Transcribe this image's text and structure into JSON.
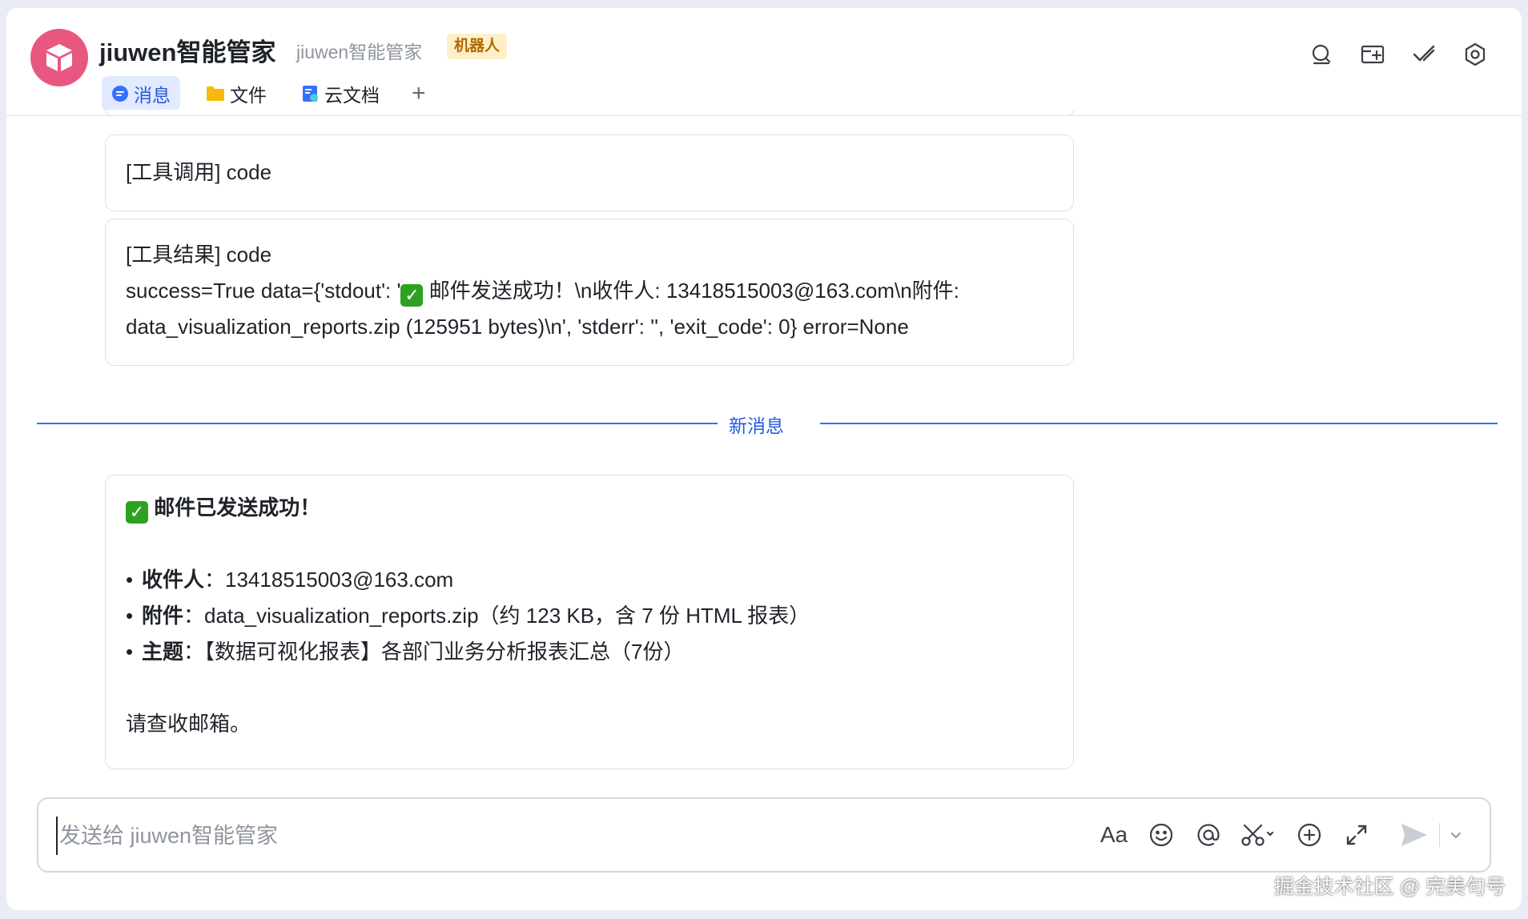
{
  "header": {
    "title": "jiuwen智能管家",
    "subtitle": "jiuwen智能管家",
    "badge": "机器人",
    "avatar_color": "#e8577f",
    "tabs": [
      {
        "label": "消息",
        "icon": "chat-bubble-icon",
        "active": true
      },
      {
        "label": "文件",
        "icon": "folder-icon",
        "active": false
      },
      {
        "label": "云文档",
        "icon": "cloud-doc-icon",
        "active": false
      }
    ],
    "add_tab": "+",
    "actions": [
      "search-icon",
      "add-screen-icon",
      "checkmark-icon",
      "settings-icon"
    ]
  },
  "messages": {
    "tool_call": "[工具调用] code",
    "tool_result_title": "[工具结果] code",
    "tool_result_line1_a": "success=True data={'stdout': '",
    "tool_result_line1_b": " 邮件发送成功！\\n收件人: 13418515003@163.com\\n附件:",
    "tool_result_line2": "data_visualization_reports.zip (125951 bytes)\\n', 'stderr': '', 'exit_code': 0} error=None",
    "divider_label": "新消息",
    "reply": {
      "headline": "邮件已发送成功！",
      "recipient_label": "收件人",
      "recipient_value": "：13418515003@163.com",
      "attachment_label": "附件",
      "attachment_value": "：data_visualization_reports.zip（约 123 KB，含 7 份 HTML 报表）",
      "subject_label": "主题",
      "subject_value": "：【数据可视化报表】各部门业务分析报表汇总（7份）",
      "footer": "请查收邮箱。",
      "bullet": "•",
      "check": "✓"
    }
  },
  "composer": {
    "placeholder": "发送给 jiuwen智能管家",
    "font_tool": "Aa",
    "tools": [
      "font-icon",
      "emoji-icon",
      "mention-icon",
      "scissors-icon",
      "add-circle-icon",
      "expand-icon",
      "send-icon",
      "chevron-down-icon"
    ]
  },
  "watermark": "掘金技术社区 @ 完美句号",
  "colors": {
    "accent": "#3370ff",
    "accent_text": "#245bdb",
    "check_green": "#2ea121",
    "badge_bg": "#fdf0c9",
    "badge_text": "#b26a00"
  }
}
